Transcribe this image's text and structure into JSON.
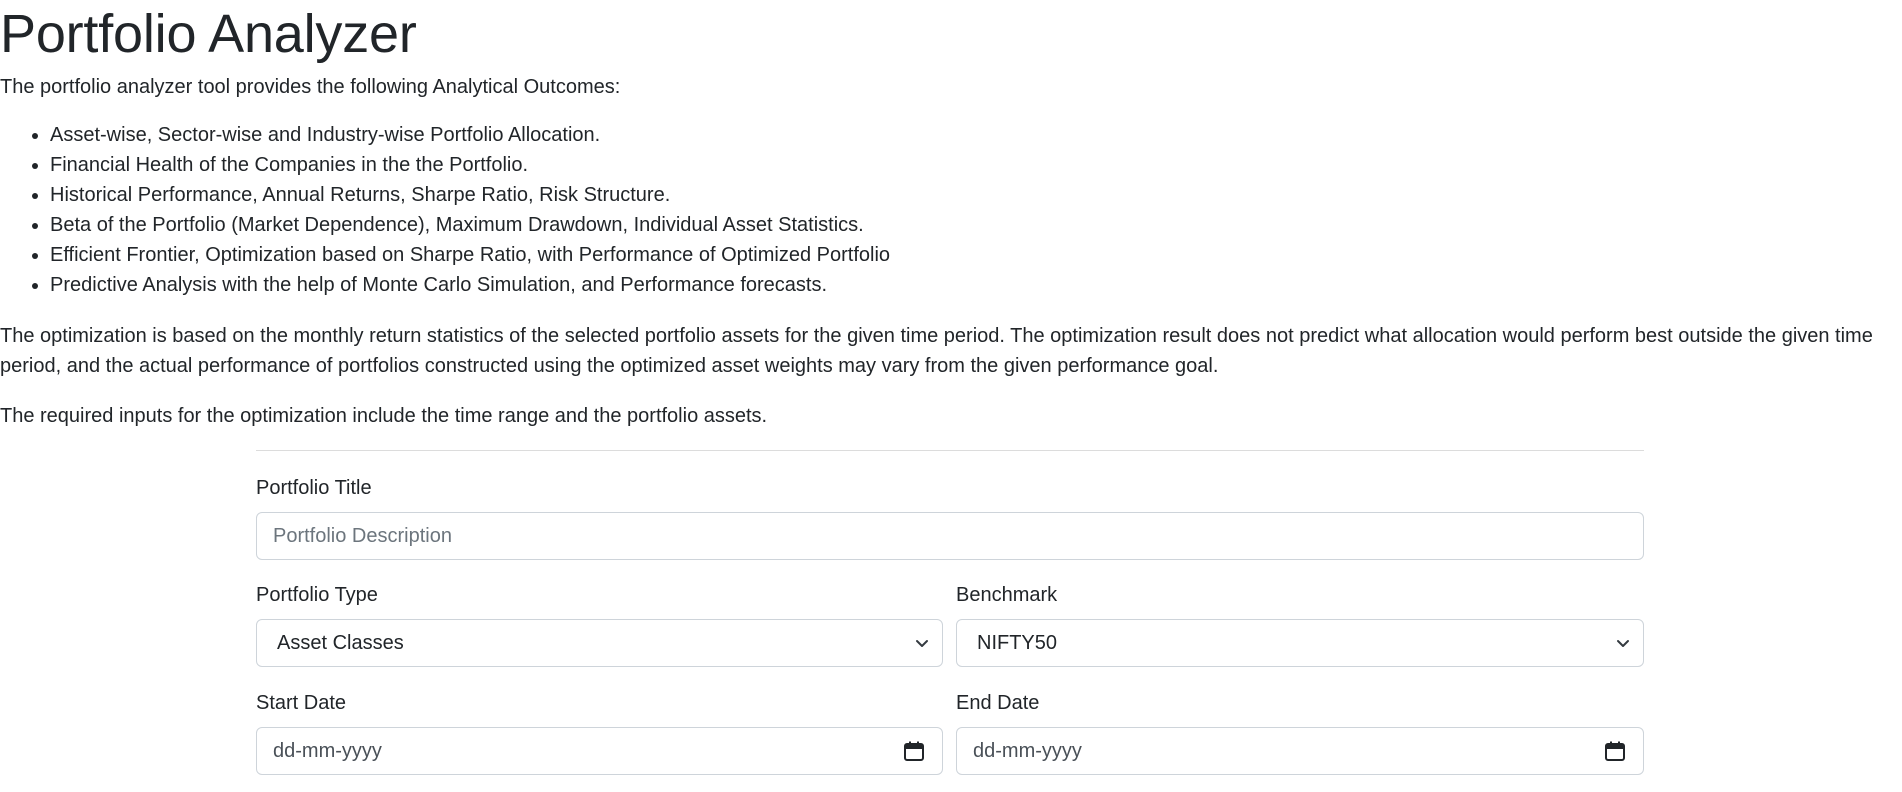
{
  "page": {
    "title": "Portfolio Analyzer",
    "intro": "The portfolio analyzer tool provides the following Analytical Outcomes:",
    "outcomes": [
      "Asset-wise, Sector-wise and Industry-wise Portfolio Allocation.",
      "Financial Health of the Companies in the the Portfolio.",
      "Historical Performance, Annual Returns, Sharpe Ratio, Risk Structure.",
      "Beta of the Portfolio (Market Dependence), Maximum Drawdown, Individual Asset Statistics.",
      "Efficient Frontier, Optimization based on Sharpe Ratio, with Performance of Optimized Portfolio",
      "Predictive Analysis with the help of Monte Carlo Simulation, and Performance forecasts."
    ],
    "paragraph1": "The optimization is based on the monthly return statistics of the selected portfolio assets for the given time period. The optimization result does not predict what allocation would perform best outside the given time period, and the actual performance of portfolios constructed using the optimized asset weights may vary from the given performance goal.",
    "paragraph2": "The required inputs for the optimization include the time range and the portfolio assets."
  },
  "form": {
    "portfolio_title": {
      "label": "Portfolio Title",
      "value": "",
      "placeholder": "Portfolio Description"
    },
    "portfolio_type": {
      "label": "Portfolio Type",
      "selected": "Asset Classes",
      "icon": "chevron-down-icon"
    },
    "benchmark": {
      "label": "Benchmark",
      "selected": "NIFTY50",
      "icon": "chevron-down-icon"
    },
    "start_date": {
      "label": "Start Date",
      "placeholder": "dd-mm-yyyy",
      "icon": "calendar-icon"
    },
    "end_date": {
      "label": "End Date",
      "placeholder": "dd-mm-yyyy",
      "icon": "calendar-icon"
    }
  },
  "colors": {
    "text": "#212529",
    "border": "#ced4da",
    "placeholder": "#6c757d",
    "divider": "#dcdcdc"
  }
}
